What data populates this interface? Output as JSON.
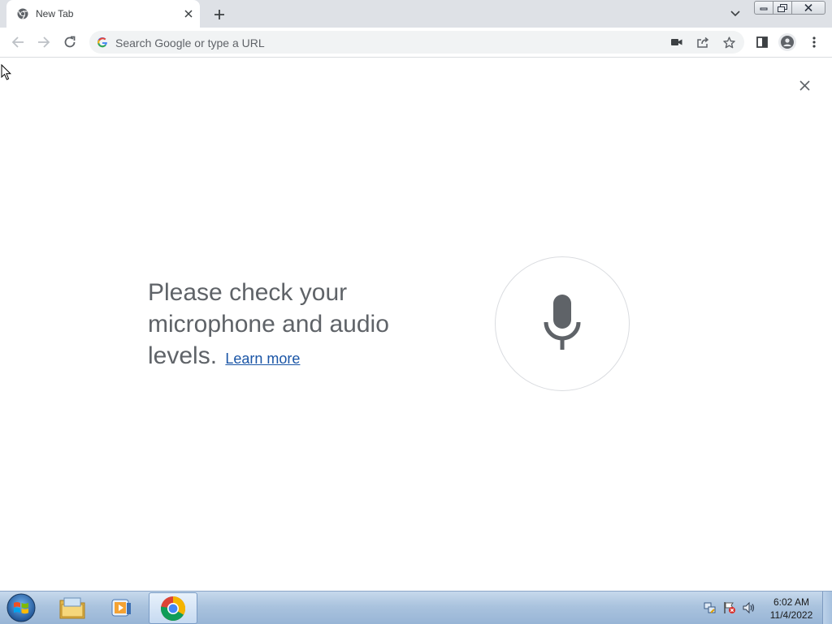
{
  "browser": {
    "tab": {
      "title": "New Tab"
    },
    "omnibox": {
      "placeholder": "Search Google or type a URL"
    }
  },
  "voice_search": {
    "message": "Please check your microphone and audio levels.",
    "learn_more_label": "Learn more"
  },
  "taskbar": {
    "clock_time": "6:02 AM",
    "clock_date": "11/4/2022",
    "pinned": [
      "windows-explorer",
      "media-player",
      "chrome"
    ]
  },
  "colors": {
    "tabstrip_bg": "#dee1e6",
    "omnibox_bg": "#f1f3f4",
    "text_gray": "#5f6368",
    "link_blue": "#1a55a6",
    "mic_gray": "#5f6368",
    "taskbar_blue": "#aac3de"
  }
}
